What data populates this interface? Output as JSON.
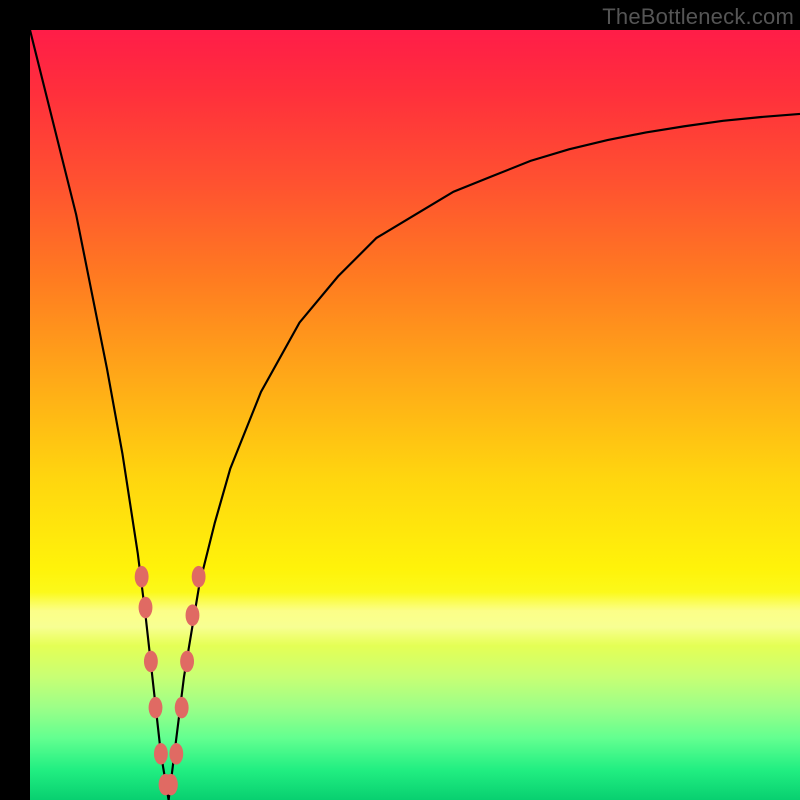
{
  "watermark": "TheBottleneck.com",
  "chart_data": {
    "type": "line",
    "title": "",
    "xlabel": "",
    "ylabel": "",
    "xlim": [
      0,
      100
    ],
    "ylim": [
      0,
      100
    ],
    "grid": false,
    "legend": false,
    "series": [
      {
        "name": "curve-left",
        "x": [
          0,
          2,
          4,
          6,
          8,
          10,
          12,
          14,
          15,
          16,
          17,
          18
        ],
        "values": [
          100,
          92,
          84,
          76,
          66,
          56,
          45,
          32,
          24,
          15,
          6,
          0
        ]
      },
      {
        "name": "curve-right",
        "x": [
          18,
          19,
          20,
          22,
          24,
          26,
          30,
          35,
          40,
          45,
          50,
          55,
          60,
          65,
          70,
          75,
          80,
          85,
          90,
          95,
          100
        ],
        "values": [
          0,
          8,
          16,
          28,
          36,
          43,
          53,
          62,
          68,
          73,
          76,
          79,
          81,
          83,
          84.5,
          85.7,
          86.7,
          87.5,
          88.2,
          88.7,
          89.1
        ]
      }
    ],
    "markers": {
      "name": "data-markers",
      "color_hex": "#e06a63",
      "points": [
        {
          "x": 14.5,
          "y": 29
        },
        {
          "x": 15.0,
          "y": 25
        },
        {
          "x": 15.7,
          "y": 18
        },
        {
          "x": 16.3,
          "y": 12
        },
        {
          "x": 17.0,
          "y": 6
        },
        {
          "x": 17.6,
          "y": 2
        },
        {
          "x": 18.3,
          "y": 2
        },
        {
          "x": 19.0,
          "y": 6
        },
        {
          "x": 19.7,
          "y": 12
        },
        {
          "x": 20.4,
          "y": 18
        },
        {
          "x": 21.1,
          "y": 24
        },
        {
          "x": 21.9,
          "y": 29
        }
      ]
    },
    "gradient_stops": [
      {
        "pct": 0,
        "color": "#ff1d48"
      },
      {
        "pct": 20,
        "color": "#ff5230"
      },
      {
        "pct": 45,
        "color": "#ffa818"
      },
      {
        "pct": 70,
        "color": "#fff30a"
      },
      {
        "pct": 88,
        "color": "#9cff88"
      },
      {
        "pct": 100,
        "color": "#08d070"
      }
    ]
  }
}
